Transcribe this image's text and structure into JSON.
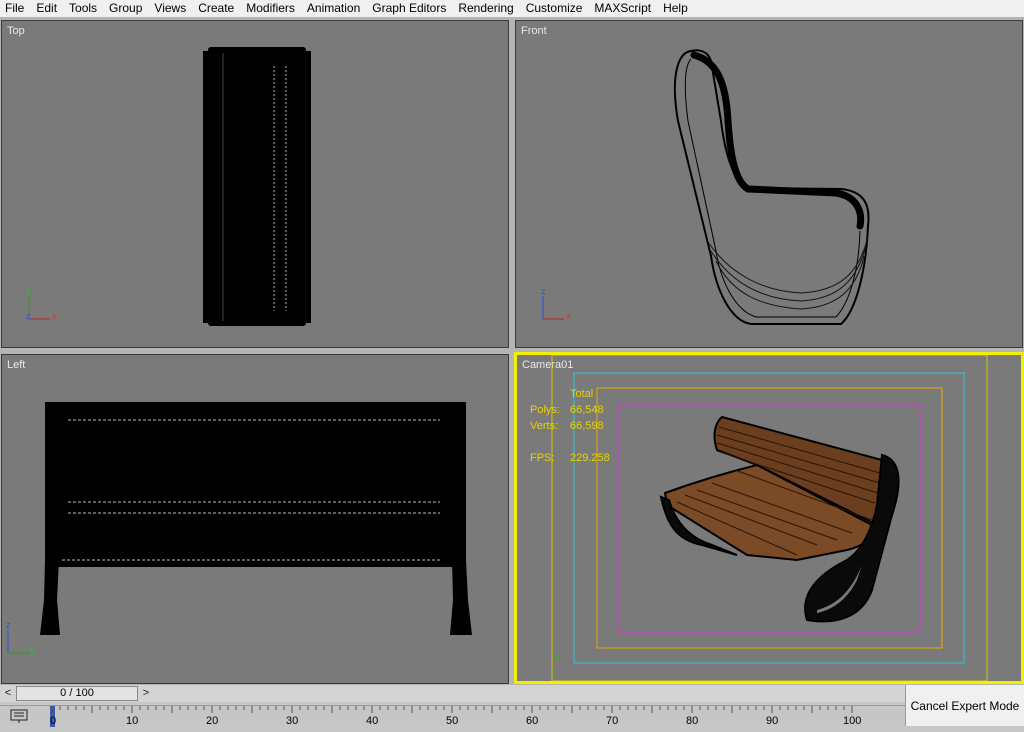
{
  "menu": [
    "File",
    "Edit",
    "Tools",
    "Group",
    "Views",
    "Create",
    "Modifiers",
    "Animation",
    "Graph Editors",
    "Rendering",
    "Customize",
    "MAXScript",
    "Help"
  ],
  "viewports": {
    "top": {
      "label": "Top"
    },
    "front": {
      "label": "Front"
    },
    "left": {
      "label": "Left"
    },
    "camera": {
      "label": "Camera01"
    }
  },
  "axes": {
    "x": "x",
    "y": "y",
    "z": "z"
  },
  "stats": {
    "total_label": "Total",
    "polys_label": "Polys:",
    "polys_value": "66,548",
    "verts_label": "Verts:",
    "verts_value": "66,598",
    "fps_label": "FPS:",
    "fps_value": "229.258"
  },
  "timeline": {
    "frame_display": "0 / 100",
    "left_arrow": "<",
    "right_arrow": ">",
    "ticks": [
      "0",
      "10",
      "20",
      "30",
      "40",
      "50",
      "60",
      "70",
      "80",
      "90",
      "100"
    ]
  },
  "cancel_expert_label": "Cancel Expert Mode",
  "colors": {
    "viewport_bg": "#7a7a7a",
    "active_border": "#f0f000",
    "stats_text": "#e8d200",
    "wood": "#7b4a26"
  }
}
